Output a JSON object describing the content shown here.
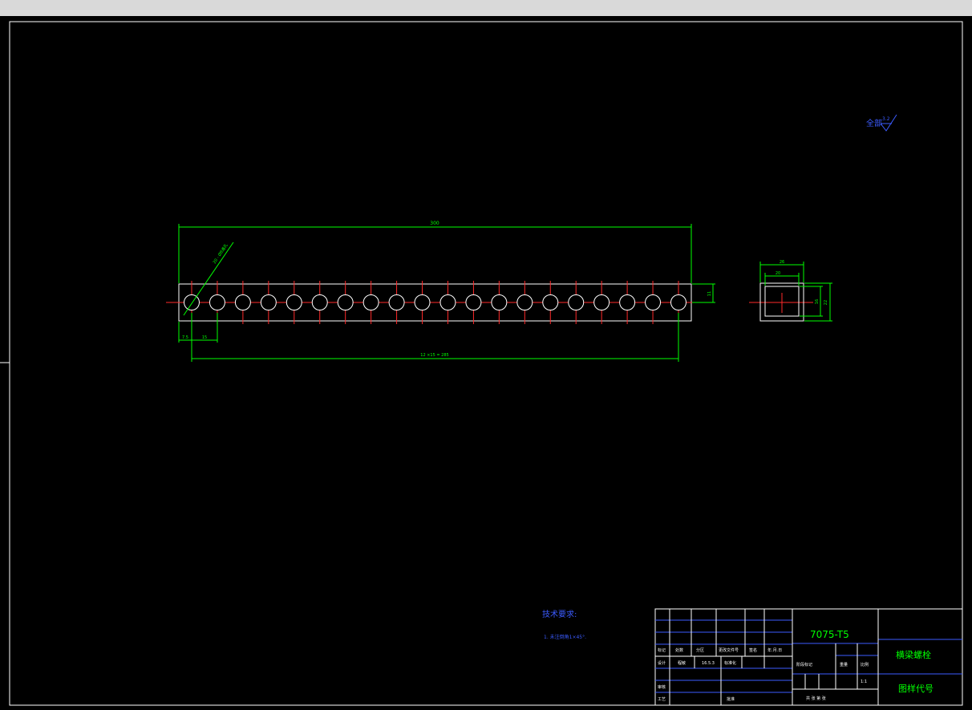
{
  "window": {
    "title": ""
  },
  "drawing": {
    "surface_symbol": {
      "label": "全部",
      "value": "3.2"
    },
    "dims": {
      "overall_length": "300",
      "hole_callout": "20 - Ø8通孔",
      "edge_offset": "7.5",
      "pitch": "15",
      "pitch_total": "12 ×15 = 285",
      "height": "11",
      "section_outer_width": "26",
      "section_inner_width": "20",
      "section_inner_height": "16",
      "section_outer_height": "22"
    },
    "tech_requirements": {
      "title": "技术要求:",
      "items": [
        "1. 未注倒角1×45°."
      ]
    },
    "hole_count": 20,
    "title_block": {
      "material": "7075-T5",
      "part_name": "横梁螺栓",
      "drawing_code": "图样代号",
      "scale": "1:1",
      "cells": {
        "biaoji": "标记",
        "chushu": "处数",
        "fenqu": "分区",
        "gaiwenjianhao": "更改文件号",
        "qianming": "签名",
        "nianyueri": "年.月.日",
        "sheji": "设计",
        "biaozhunhua": "标准化",
        "shenhe": "审核",
        "gongyi": "工艺",
        "pizhun": "批准",
        "jieduan": "阶段标记",
        "zhongliang": "重量",
        "bili": "比例",
        "gongzhang": "共 张 第 张",
        "date_text": "16.5.3",
        "author": "程敏"
      }
    }
  }
}
